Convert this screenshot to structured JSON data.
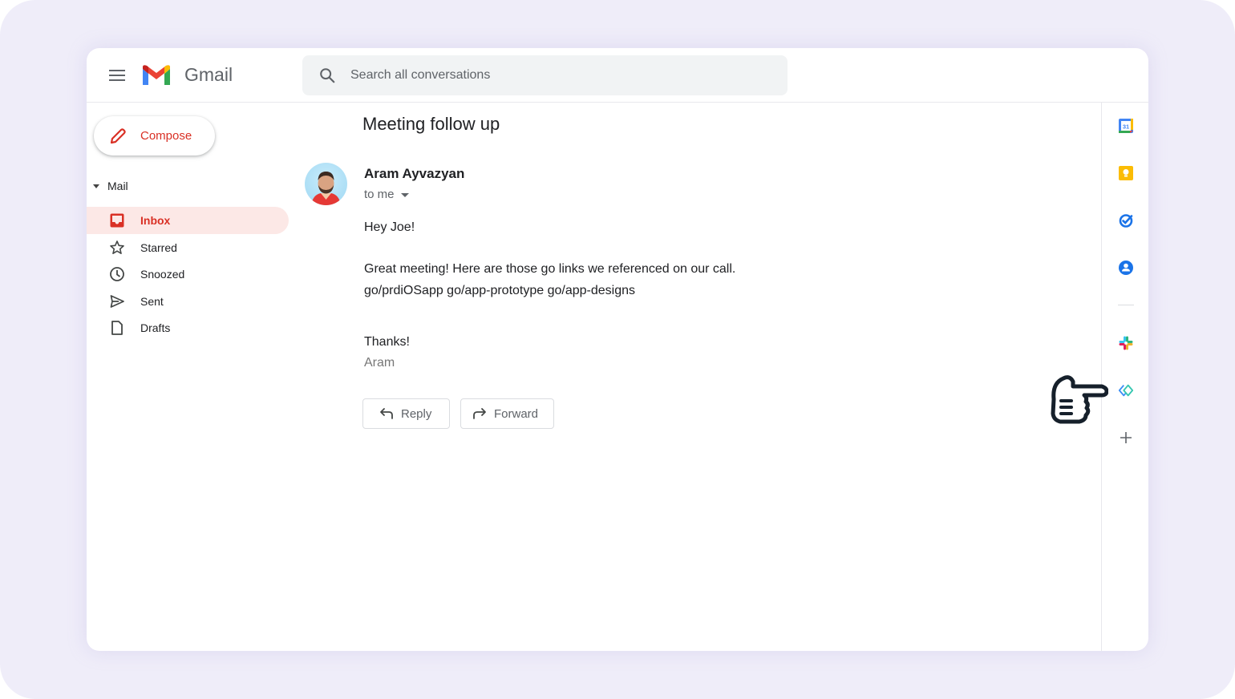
{
  "app": {
    "name": "Gmail"
  },
  "header": {
    "menu_icon": "hamburger-menu-icon",
    "logo_icon": "gmail-m-logo",
    "brand": "Gmail",
    "search": {
      "placeholder": "Search all conversations",
      "value": "",
      "icon": "search-icon"
    }
  },
  "sidebar": {
    "compose_label": "Compose",
    "section_label": "Mail",
    "items": [
      {
        "label": "Inbox",
        "icon": "inbox-icon",
        "active": true
      },
      {
        "label": "Starred",
        "icon": "star-icon",
        "active": false
      },
      {
        "label": "Snoozed",
        "icon": "clock-icon",
        "active": false
      },
      {
        "label": "Sent",
        "icon": "send-icon",
        "active": false
      },
      {
        "label": "Drafts",
        "icon": "draft-icon",
        "active": false
      }
    ]
  },
  "email": {
    "subject": "Meeting follow up",
    "sender": "Aram Ayvazyan",
    "recipient_label": "to me",
    "greeting": "Hey Joe!",
    "line1": "Great meeting! Here are those go links we referenced on our call.",
    "links": "go/prdiOSapp go/app-prototype go/app-designs",
    "closing": "Thanks!",
    "signature": "Aram",
    "reply_label": "Reply",
    "forward_label": "Forward"
  },
  "right_rail": {
    "icons": [
      "calendar-icon",
      "keep-icon",
      "tasks-icon",
      "contacts-icon",
      "slack-icon",
      "golinks-icon",
      "add-icon"
    ],
    "calendar_day": "31"
  },
  "colors": {
    "accent_red": "#d93025",
    "active_bg": "#fce8e6",
    "frame_bg": "#EFEDF9"
  }
}
